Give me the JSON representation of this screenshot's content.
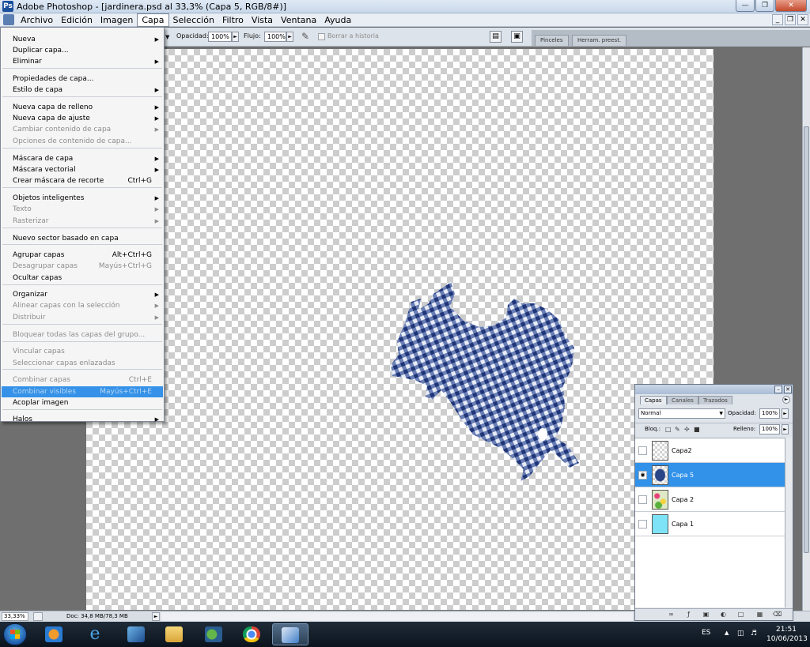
{
  "window": {
    "title": "Adobe Photoshop - [jardinera.psd al 33,3% (Capa 5, RGB/8#)]"
  },
  "menubar": {
    "items": [
      "Archivo",
      "Edición",
      "Imagen",
      "Capa",
      "Selección",
      "Filtro",
      "Vista",
      "Ventana",
      "Ayuda"
    ],
    "active": "Capa"
  },
  "options": {
    "opacity_label": "Opacidad:",
    "opacity_value": "100%",
    "flow_label": "Flujo:",
    "flow_value": "100%",
    "erase_history_label": "Borrar a historia"
  },
  "panel_well": {
    "tabs": [
      "Pinceles",
      "Herram. preest."
    ]
  },
  "capa_menu": {
    "items": [
      {
        "label": "Nueva",
        "submenu": true
      },
      {
        "label": "Duplicar capa..."
      },
      {
        "label": "Eliminar",
        "submenu": true
      },
      {
        "label": "Propiedades de capa..."
      },
      {
        "label": "Estilo de capa",
        "submenu": true
      },
      {
        "label": "Nueva capa de relleno",
        "submenu": true
      },
      {
        "label": "Nueva capa de ajuste",
        "submenu": true
      },
      {
        "label": "Cambiar contenido de capa",
        "submenu": true,
        "disabled": true
      },
      {
        "label": "Opciones de contenido de capa...",
        "disabled": true
      },
      {
        "label": "Máscara de capa",
        "submenu": true
      },
      {
        "label": "Máscara vectorial",
        "submenu": true
      },
      {
        "label": "Crear máscara de recorte",
        "shortcut": "Ctrl+G"
      },
      {
        "label": "Objetos inteligentes",
        "submenu": true
      },
      {
        "label": "Texto",
        "submenu": true,
        "disabled": true
      },
      {
        "label": "Rasterizar",
        "submenu": true,
        "disabled": true
      },
      {
        "label": "Nuevo sector basado en capa"
      },
      {
        "label": "Agrupar capas",
        "shortcut": "Alt+Ctrl+G"
      },
      {
        "label": "Desagrupar capas",
        "shortcut": "Mayús+Ctrl+G",
        "disabled": true
      },
      {
        "label": "Ocultar capas"
      },
      {
        "label": "Organizar",
        "submenu": true
      },
      {
        "label": "Alinear capas con la selección",
        "submenu": true,
        "disabled": true
      },
      {
        "label": "Distribuir",
        "submenu": true,
        "disabled": true
      },
      {
        "label": "Bloquear todas las capas del grupo...",
        "disabled": true
      },
      {
        "label": "Vincular capas",
        "disabled": true
      },
      {
        "label": "Seleccionar capas enlazadas",
        "disabled": true
      },
      {
        "label": "Combinar capas",
        "shortcut": "Ctrl+E",
        "disabled": true
      },
      {
        "label": "Combinar visibles",
        "shortcut": "Mayús+Ctrl+E",
        "highlighted": true
      },
      {
        "label": "Acoplar imagen"
      },
      {
        "label": "Halos",
        "submenu": true
      }
    ]
  },
  "layers_panel": {
    "tabs": [
      "Capas",
      "Canales",
      "Trazados"
    ],
    "active_tab": "Capas",
    "blend_mode": "Normal",
    "opacity_label": "Opacidad:",
    "opacity_value": "100%",
    "lock_label": "Bloq.:",
    "fill_label": "Relleno:",
    "fill_value": "100%",
    "layers": [
      {
        "name": "Capa2",
        "visible": false,
        "thumb": "transparent"
      },
      {
        "name": "Capa 5",
        "visible": true,
        "selected": true,
        "thumb": "shirt"
      },
      {
        "name": "Capa 2",
        "visible": false,
        "thumb": "flowers"
      },
      {
        "name": "Capa 1",
        "visible": false,
        "thumb": "cyan"
      }
    ]
  },
  "status": {
    "zoom": "33,33%",
    "doc_info": "Doc: 34,8 MB/78,3 MB"
  },
  "taskbar": {
    "language": "ES",
    "time": "21:51",
    "date": "10/06/2013"
  },
  "colors": {
    "accent_selection": "#3292ea",
    "gingham_blue": "#1f3577"
  }
}
